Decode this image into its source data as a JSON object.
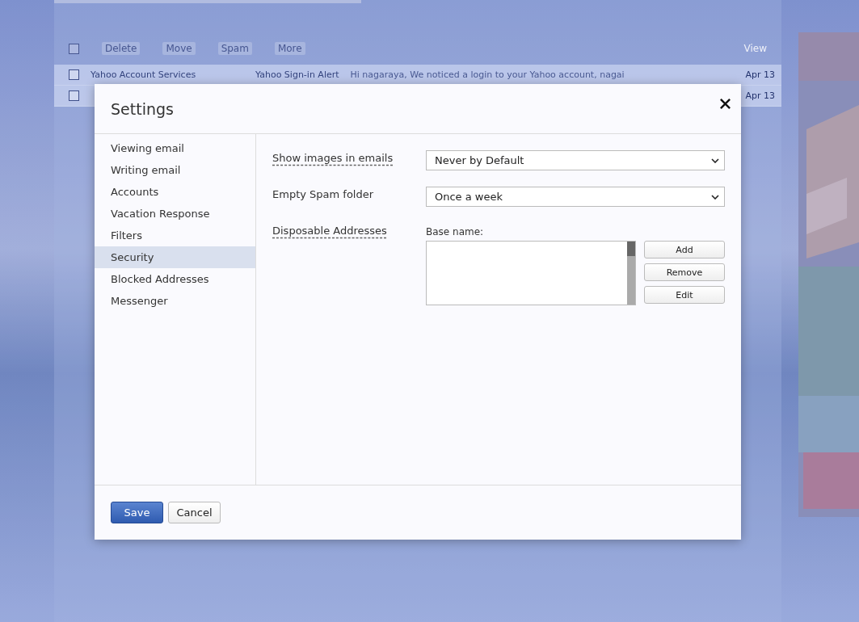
{
  "background": {
    "toolbar": [
      "Delete",
      "Move",
      "Spam",
      "More"
    ],
    "view_menu": "View",
    "select_all": {
      "checked": false
    },
    "messages": [
      {
        "checked": false,
        "sender": "Yahoo Account Services",
        "subject": "Yahoo Sign-in Alert",
        "snippet": "Hi nagaraya, We noticed a login to your Yahoo account, nagai",
        "date": "Apr 13"
      },
      {
        "checked": false,
        "date": "Apr 13"
      }
    ]
  },
  "dialog": {
    "title": "Settings",
    "sidebar": {
      "items": [
        {
          "label": "Viewing email",
          "selected": false
        },
        {
          "label": "Writing email",
          "selected": false
        },
        {
          "label": "Accounts",
          "selected": false
        },
        {
          "label": "Vacation Response",
          "selected": false
        },
        {
          "label": "Filters",
          "selected": false
        },
        {
          "label": "Security",
          "selected": true
        },
        {
          "label": "Blocked Addresses",
          "selected": false
        },
        {
          "label": "Messenger",
          "selected": false
        }
      ]
    },
    "settings": [
      {
        "kind": "select",
        "label": "Show images in emails",
        "help": true,
        "value": "Never by Default"
      },
      {
        "kind": "select",
        "label": "Empty Spam folder",
        "help": false,
        "value": "Once a week"
      },
      {
        "kind": "addresses",
        "label": "Disposable Addresses",
        "help": true,
        "base_label": "Base name:",
        "buttons": [
          "Add",
          "Remove",
          "Edit"
        ]
      }
    ],
    "buttons": [
      {
        "label": "Save",
        "primary": true
      },
      {
        "label": "Cancel",
        "primary": false
      }
    ]
  }
}
